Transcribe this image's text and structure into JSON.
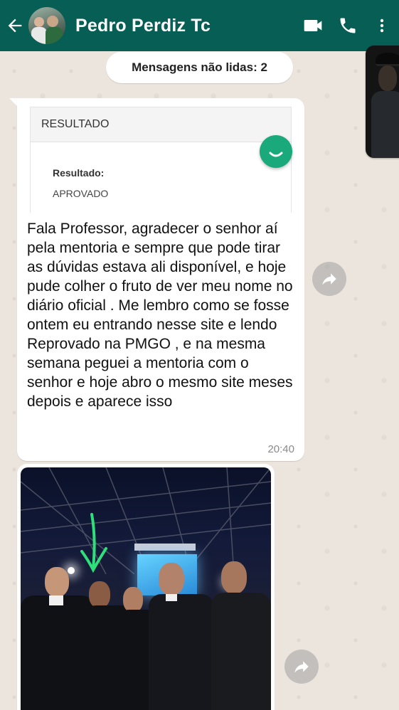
{
  "header": {
    "contact_name": "Pedro Perdiz Tc",
    "icons": [
      "back-arrow-icon",
      "video-call-icon",
      "phone-icon",
      "more-vert-icon"
    ],
    "background_color": "#075e54"
  },
  "chat": {
    "unread_label": "Mensagens não lidas: 2",
    "message": {
      "embed_header": "RESULTADO",
      "embed_field_label": "Resultado:",
      "embed_field_value": "APROVADO",
      "text": "Fala Professor, agradecer o senhor aí pela mentoria e sempre que pode tirar as dúvidas estava ali disponível, e hoje pude colher o fruto de ver meu nome no diário oficial . Me lembro como se fosse ontem eu entrando nesse site e lendo Reprovado na PMGO , e na mesma semana peguei a mentoria com o senhor e hoje abro o mesmo site meses depois e aparece isso",
      "time": "20:40"
    },
    "photo_message": {
      "description_icon": "forward-icon"
    }
  },
  "colors": {
    "chat_background": "#ece5dd",
    "bubble": "#ffffff",
    "accent_green": "#1aa97a"
  }
}
